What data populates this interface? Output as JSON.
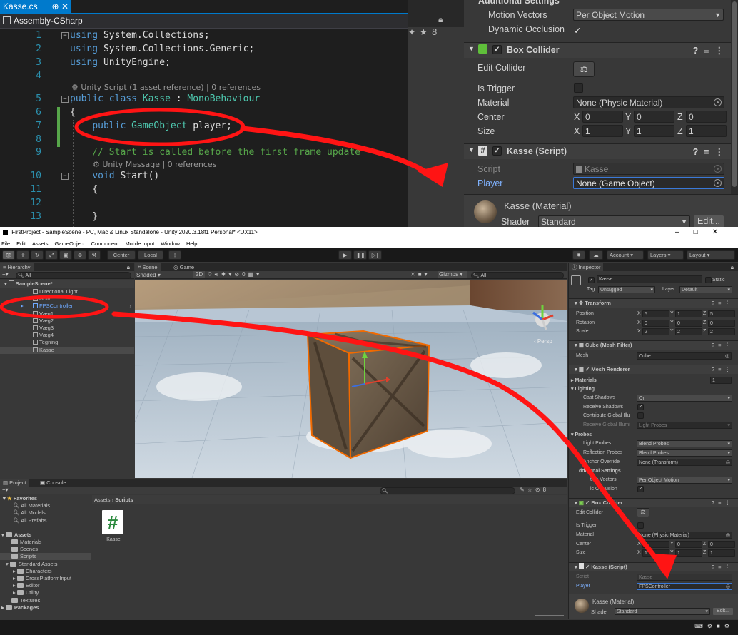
{
  "vs": {
    "tab_title": "Kasse.cs",
    "tab_pin": "⊕",
    "tab_close": "✕",
    "project": "Assembly-CSharp",
    "lines": [
      {
        "n": "1",
        "code": [
          [
            "kw",
            "using"
          ],
          [
            "t",
            " System.Collections;"
          ]
        ],
        "fold": "−"
      },
      {
        "n": "2",
        "code": [
          [
            "kw",
            "using"
          ],
          [
            "t",
            " System.Collections.Generic;"
          ]
        ]
      },
      {
        "n": "3",
        "code": [
          [
            "kw",
            "using"
          ],
          [
            "t",
            " UnityEngine;"
          ]
        ]
      },
      {
        "n": "4",
        "code": []
      },
      {
        "n": "5",
        "code": [
          [
            "kw",
            "public"
          ],
          [
            "t",
            " "
          ],
          [
            "kw",
            "class"
          ],
          [
            "t",
            " "
          ],
          [
            "ty",
            "Kasse"
          ],
          [
            "t",
            " : "
          ],
          [
            "ty",
            "MonoBehaviour"
          ]
        ],
        "fold": "−"
      },
      {
        "n": "6",
        "code": [
          [
            "t",
            "{"
          ]
        ]
      },
      {
        "n": "7",
        "code": [
          [
            "t",
            "    "
          ],
          [
            "kw",
            "public"
          ],
          [
            "t",
            " "
          ],
          [
            "ty",
            "GameObject"
          ],
          [
            "t",
            " player;"
          ]
        ]
      },
      {
        "n": "8",
        "code": []
      },
      {
        "n": "9",
        "code": [
          [
            "cm",
            "    // Start is called before the first frame update"
          ]
        ]
      },
      {
        "n": "10",
        "code": [
          [
            "t",
            "    "
          ],
          [
            "kw",
            "void"
          ],
          [
            "t",
            " Start()"
          ]
        ],
        "fold": "−"
      },
      {
        "n": "11",
        "code": [
          [
            "t",
            "    {"
          ]
        ]
      },
      {
        "n": "12",
        "code": []
      },
      {
        "n": "13",
        "code": [
          [
            "t",
            "    }"
          ]
        ]
      }
    ],
    "lens1": "Unity Script (1 asset reference) | 0 references",
    "lens2": "Unity Message | 0 references"
  },
  "inspector_top": {
    "section_title": "Additional Settings",
    "motion_vectors_label": "Motion Vectors",
    "motion_vectors_value": "Per Object Motion",
    "dynamic_occlusion_label": "Dynamic Occlusion",
    "box_collider_title": "Box Collider",
    "edit_collider_label": "Edit Collider",
    "is_trigger_label": "Is Trigger",
    "material_label": "Material",
    "material_value": "None (Physic Material)",
    "center_label": "Center",
    "center": {
      "x": "0",
      "y": "0",
      "z": "0"
    },
    "size_label": "Size",
    "size": {
      "x": "1",
      "y": "1",
      "z": "1"
    },
    "script_component_title": "Kasse (Script)",
    "script_label": "Script",
    "script_value": "Kasse",
    "player_label": "Player",
    "player_value": "None (Game Object)",
    "material_title": "Kasse (Material)",
    "shader_label": "Shader",
    "shader_value": "Standard",
    "edit_button": "Edit...",
    "partial_stat": "8"
  },
  "unity": {
    "title": "FirstProject - SampleScene - PC, Mac & Linux Standalone - Unity 2020.3.18f1 Personal* <DX11>",
    "menus": [
      "File",
      "Edit",
      "Assets",
      "GameObject",
      "Component",
      "Mobile Input",
      "Window",
      "Help"
    ],
    "toolbar": {
      "center": "Center",
      "local": "Local",
      "account": "Account",
      "layers": "Layers",
      "layout": "Layout"
    },
    "hierarchy": {
      "tab": "Hierarchy",
      "search": "All",
      "scene": "SampleScene*",
      "items": [
        "Directional Light",
        "Gulv",
        "FPSController",
        "Væg1",
        "Væg2",
        "Væg3",
        "Væg4",
        "Tegning",
        "Kasse"
      ]
    },
    "scene_view": {
      "tab_scene": "Scene",
      "tab_game": "Game",
      "shading": "Shaded",
      "mode_2d": "2D",
      "gizmos": "Gizmos",
      "search": "All",
      "persp": "Persp",
      "hidden_count": "0"
    },
    "project": {
      "tab_project": "Project",
      "tab_console": "Console",
      "breadcrumb_root": "Assets",
      "breadcrumb_current": "Scripts",
      "favorites": "Favorites",
      "fav_items": [
        "All Materials",
        "All Models",
        "All Prefabs"
      ],
      "assets": "Assets",
      "asset_items": [
        "Materials",
        "Scenes",
        "Scripts",
        "Standard Assets"
      ],
      "std_items": [
        "Characters",
        "CrossPlatformInput",
        "Editor",
        "Utility"
      ],
      "textures": "Textures",
      "packages": "Packages",
      "file_name": "Kasse",
      "count": "8"
    },
    "inspector": {
      "tab": "Inspector",
      "object_name": "Kasse",
      "static": "Static",
      "tag_label": "Tag",
      "tag_value": "Untagged",
      "layer_label": "Layer",
      "layer_value": "Default",
      "transform": "Transform",
      "position_label": "Position",
      "position": {
        "x": "5",
        "y": "1",
        "z": "5"
      },
      "rotation_label": "Rotation",
      "rotation": {
        "x": "0",
        "y": "0",
        "z": "0"
      },
      "scale_label": "Scale",
      "scale": {
        "x": "2",
        "y": "2",
        "z": "2"
      },
      "mesh_filter": "Cube (Mesh Filter)",
      "mesh_label": "Mesh",
      "mesh_value": "Cube",
      "mesh_renderer": "Mesh Renderer",
      "materials_label": "Materials",
      "materials_count": "1",
      "lighting": "Lighting",
      "cast_shadows_label": "Cast Shadows",
      "cast_shadows_value": "On",
      "receive_shadows_label": "Receive Shadows",
      "contribute_gi_label": "Contribute Global Illu",
      "receive_gi_label": "Receive Global Illumi",
      "receive_gi_value": "Light Probes",
      "probes": "Probes",
      "light_probes_label": "Light Probes",
      "light_probes_value": "Blend Probes",
      "reflection_probes_label": "Reflection Probes",
      "reflection_probes_value": "Blend Probes",
      "anchor_override_label": "Anchor Override",
      "anchor_override_value": "None (Transform)",
      "additional_settings": "dditional Settings",
      "motion_vectors_label": "tion Vectors",
      "motion_vectors_value": "Per Object Motion",
      "dynamic_occlusion_label": "ic Occlusion",
      "box_collider": "Box Collider",
      "edit_collider_label": "Edit Collider",
      "is_trigger_label": "Is Trigger",
      "material_label": "Material",
      "material_value": "None (Physic Material)",
      "center_label": "Center",
      "center": {
        "x": "0",
        "y": "0",
        "z": "0"
      },
      "size_label": "Size",
      "size": {
        "x": "1",
        "y": "1",
        "z": "1"
      },
      "script_component": "Kasse (Script)",
      "script_label": "Script",
      "script_value": "Kasse",
      "player_label": "Player",
      "player_value": "FPSController",
      "material_title": "Kasse (Material)",
      "shader_label": "Shader",
      "shader_value": "Standard",
      "edit_button": "Edit..."
    }
  },
  "colors": {
    "vs_accent": "#007acc",
    "unity_bg": "#383838",
    "annotation": "#ff1414",
    "player_link": "#4d9bff"
  }
}
